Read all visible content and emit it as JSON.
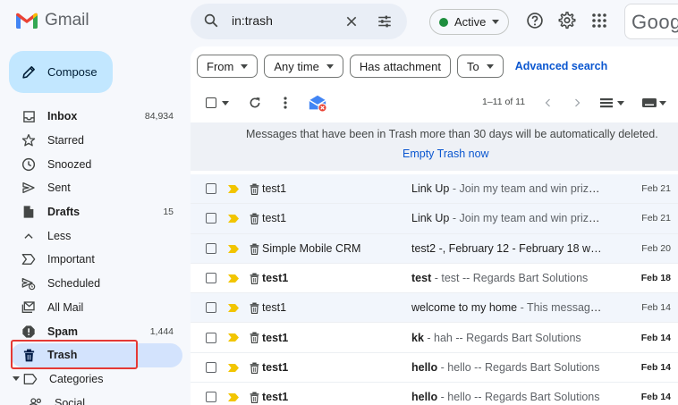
{
  "app": {
    "name": "Gmail"
  },
  "search": {
    "query": "in:trash"
  },
  "header": {
    "status_label": "Active",
    "account_label": "Googl"
  },
  "compose": {
    "label": "Compose"
  },
  "sidebar": {
    "items": [
      {
        "label": "Inbox",
        "count": "84,934",
        "icon": "inbox-icon",
        "bold": true
      },
      {
        "label": "Starred",
        "count": "",
        "icon": "star-icon",
        "bold": false
      },
      {
        "label": "Snoozed",
        "count": "",
        "icon": "clock-icon",
        "bold": false
      },
      {
        "label": "Sent",
        "count": "",
        "icon": "send-icon",
        "bold": false
      },
      {
        "label": "Drafts",
        "count": "15",
        "icon": "draft-icon",
        "bold": true
      },
      {
        "label": "Less",
        "count": "",
        "icon": "chevron-up-icon",
        "bold": false
      },
      {
        "label": "Important",
        "count": "",
        "icon": "important-icon",
        "bold": false
      },
      {
        "label": "Scheduled",
        "count": "",
        "icon": "scheduled-icon",
        "bold": false
      },
      {
        "label": "All Mail",
        "count": "",
        "icon": "all-mail-icon",
        "bold": false
      },
      {
        "label": "Spam",
        "count": "1,444",
        "icon": "spam-icon",
        "bold": true
      },
      {
        "label": "Trash",
        "count": "",
        "icon": "trash-icon",
        "bold": true
      },
      {
        "label": "Categories",
        "count": "",
        "icon": "label-icon",
        "bold": false
      },
      {
        "label": "Social",
        "count": "",
        "icon": "people-icon",
        "bold": false
      }
    ],
    "active": "Trash"
  },
  "filters": {
    "chips": [
      "From",
      "Any time",
      "Has attachment",
      "To"
    ],
    "advanced": "Advanced search"
  },
  "toolbar": {
    "pagination": "1–11 of 11"
  },
  "notice": {
    "message": "Messages that have been in Trash more than 30 days will be automatically deleted.",
    "action": "Empty Trash now"
  },
  "emails": [
    {
      "sender": "test1",
      "subject": "Link Up",
      "preview": " - Join my team and win prizes...",
      "date": "Feb 21",
      "unread": false
    },
    {
      "sender": "test1",
      "subject": "Link Up",
      "preview": " - Join my team and win prizes...",
      "date": "Feb 21",
      "unread": false
    },
    {
      "sender": "Simple Mobile CRM",
      "subject": "test2 -, February 12 - February 18 wee...",
      "preview": "",
      "date": "Feb 20",
      "unread": false
    },
    {
      "sender": "test1",
      "subject": "test",
      "preview": " - test -- Regards Bart Solutions",
      "date": "Feb 18",
      "unread": true
    },
    {
      "sender": "test1",
      "subject": "welcome to my home",
      "preview": " - This message ...",
      "date": "Feb 14",
      "unread": false
    },
    {
      "sender": "test1",
      "subject": "kk",
      "preview": " - hah -- Regards Bart Solutions",
      "date": "Feb 14",
      "unread": true
    },
    {
      "sender": "test1",
      "subject": "hello",
      "preview": " - hello -- Regards Bart Solutions",
      "date": "Feb 14",
      "unread": true
    },
    {
      "sender": "test1",
      "subject": "hello",
      "preview": " - hello -- Regards Bart Solutions",
      "date": "Feb 14",
      "unread": true
    }
  ],
  "colors": {
    "accent": "#0b57d0",
    "compose_bg": "#c2e7ff",
    "active_nav_bg": "#d3e3fd",
    "highlight": "#e53935",
    "importance_marker": "#f2c500"
  }
}
